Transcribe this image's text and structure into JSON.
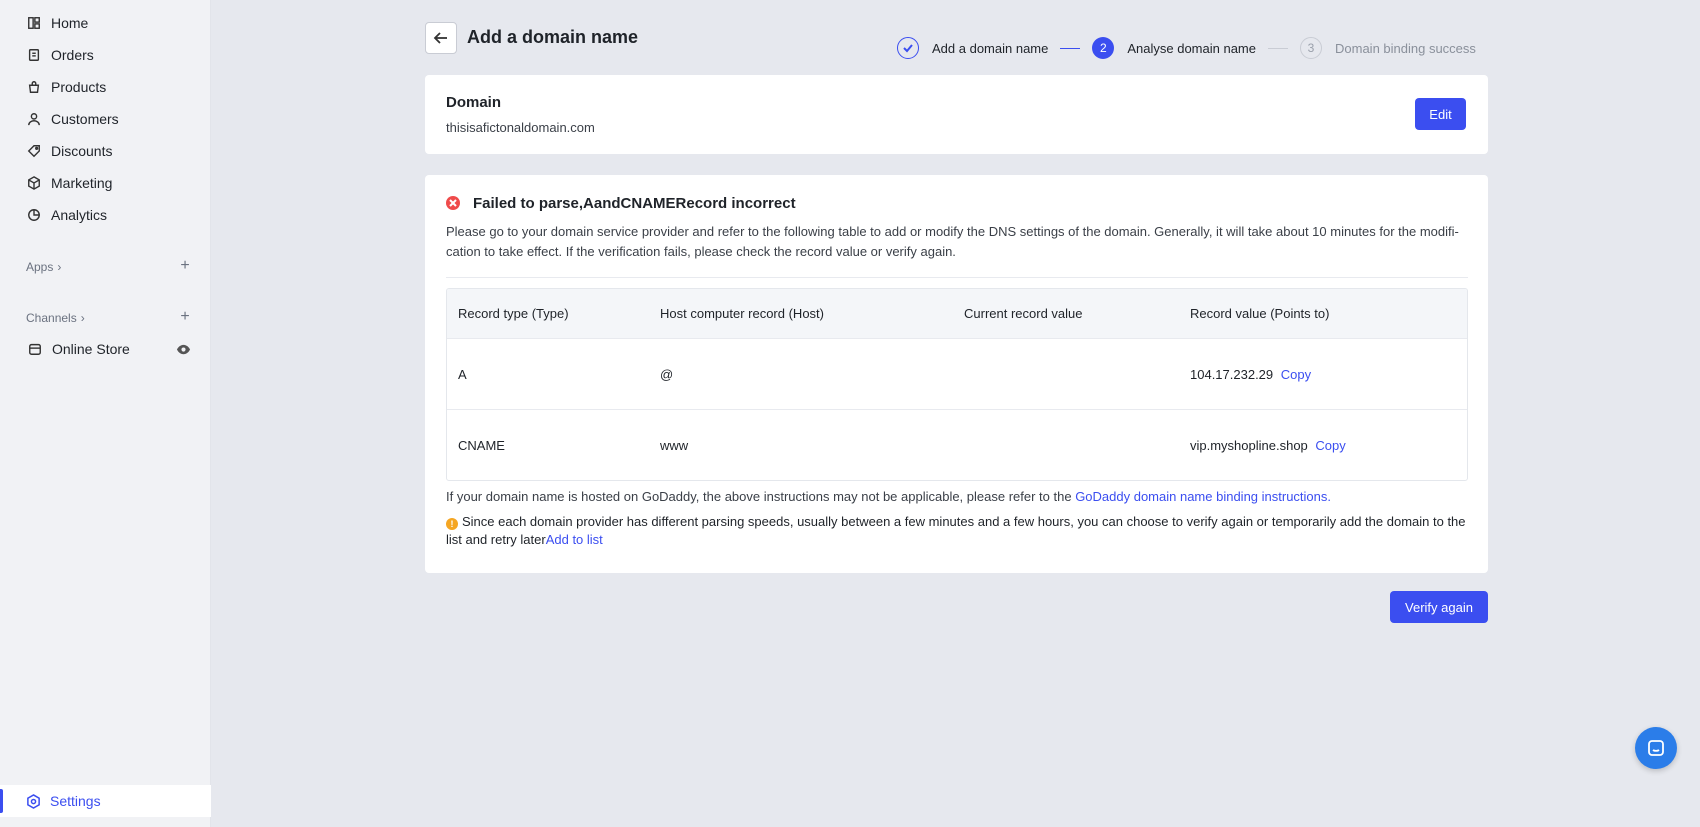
{
  "sidebar": {
    "nav": [
      {
        "label": "Home",
        "icon": "home-icon"
      },
      {
        "label": "Orders",
        "icon": "orders-icon"
      },
      {
        "label": "Products",
        "icon": "products-icon"
      },
      {
        "label": "Customers",
        "icon": "customers-icon"
      },
      {
        "label": "Discounts",
        "icon": "discounts-icon"
      },
      {
        "label": "Marketing",
        "icon": "marketing-icon"
      },
      {
        "label": "Analytics",
        "icon": "analytics-icon"
      }
    ],
    "apps_label": "Apps",
    "channels_label": "Channels",
    "online_store": "Online Store",
    "settings": "Settings"
  },
  "header": {
    "title": "Add a domain name"
  },
  "steps": [
    {
      "label": "Add a domain name",
      "state": "done"
    },
    {
      "number": "2",
      "label": "Analyse domain name",
      "state": "active"
    },
    {
      "number": "3",
      "label": "Domain binding success",
      "state": "todo"
    }
  ],
  "domain_card": {
    "title": "Domain",
    "value": "thisisafictonaldomain.com",
    "edit_label": "Edit"
  },
  "result": {
    "title": "Failed to parse,AandCNAMERecord incorrect",
    "description": "Please go to your domain service provider and refer to the following table to add or modify the DNS settings of the domain. Generally, it will take about 10 minutes for the modifi-cation to take effect. If the verification fails, please check the record value or verify again.",
    "table": {
      "headers": [
        "Record type (Type)",
        "Host computer record (Host)",
        "Current record value",
        "Record value (Points to)"
      ],
      "rows": [
        {
          "type": "A",
          "host": "@",
          "current": "",
          "points_to": "104.17.232.29",
          "copy": "Copy"
        },
        {
          "type": "CNAME",
          "host": "www",
          "current": "",
          "points_to": "vip.myshopline.shop",
          "copy": "Copy"
        }
      ]
    },
    "note_text": "If your domain name is hosted on GoDaddy, the above instructions may not be applicable, please refer to the ",
    "note_link": "GoDaddy domain name binding instructions.",
    "warn_text": "Since each domain provider has different parsing speeds, usually between a few minutes and a few hours, you can choose to verify again or temporarily add the domain to the list and retry later",
    "warn_link": "Add to list"
  },
  "verify_label": "Verify again",
  "colors": {
    "accent": "#3b4ef0",
    "error": "#ef4b4b",
    "warning": "#f5a623",
    "background": "#e6e8ee"
  }
}
